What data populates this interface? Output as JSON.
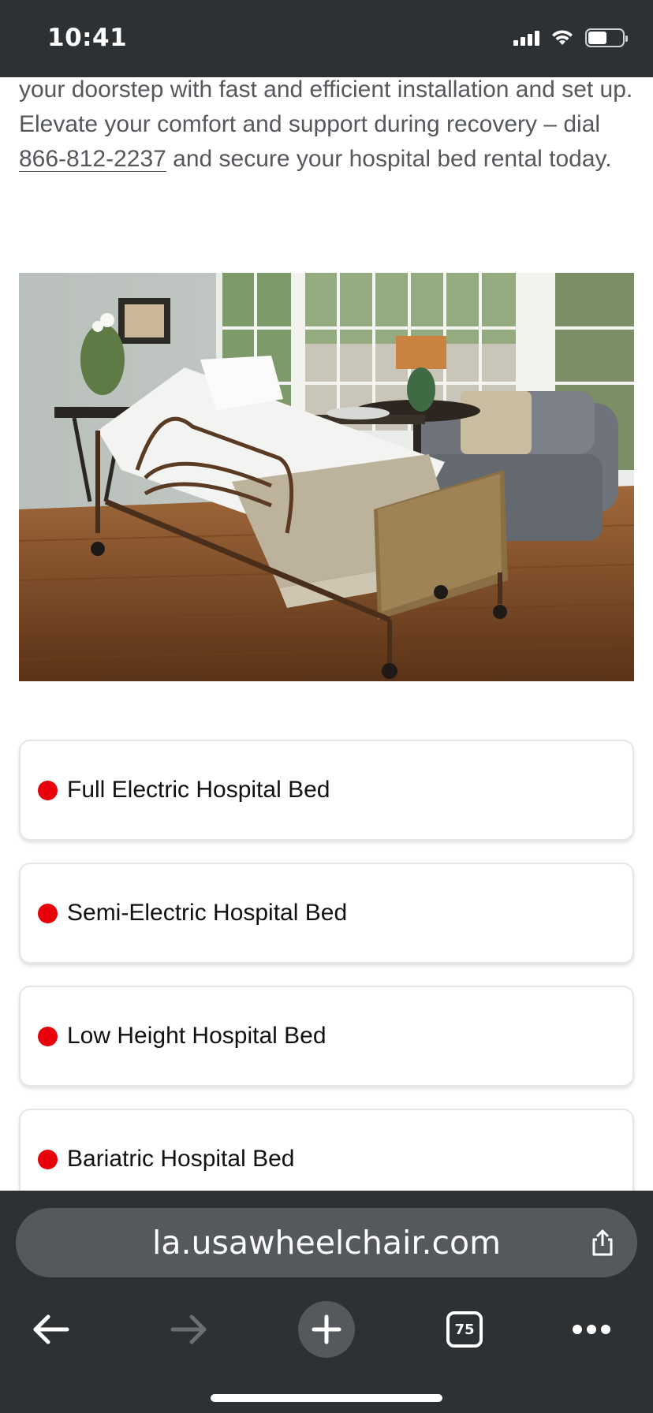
{
  "status_bar": {
    "time": "10:41",
    "icons": [
      "cellular-signal-icon",
      "wifi-icon",
      "battery-icon"
    ]
  },
  "intro": {
    "line_1": "your doorstep with fast and efficient installation and set up. Elevate your comfort and support during recovery – dial ",
    "phone": "866-812-2237",
    "line_2": " and secure your hospital bed rental today."
  },
  "hero_image": {
    "subject": "hospital bed in a sunroom with armchair and table lamp"
  },
  "bed_types": [
    {
      "label": "Full Electric Hospital Bed"
    },
    {
      "label": "Semi-Electric Hospital Bed"
    },
    {
      "label": "Low Height Hospital Bed"
    },
    {
      "label": "Bariatric Hospital Bed"
    }
  ],
  "browser": {
    "url": "la.usawheelchair.com",
    "tab_count": "75",
    "icons": [
      "share-icon",
      "back-arrow-icon",
      "forward-arrow-icon",
      "plus-icon",
      "tabs-icon",
      "more-icon"
    ]
  },
  "colors": {
    "chrome": "#2e3134",
    "url_pill": "#55595d",
    "bullet": "#e8000b",
    "body_text": "#55595d"
  }
}
